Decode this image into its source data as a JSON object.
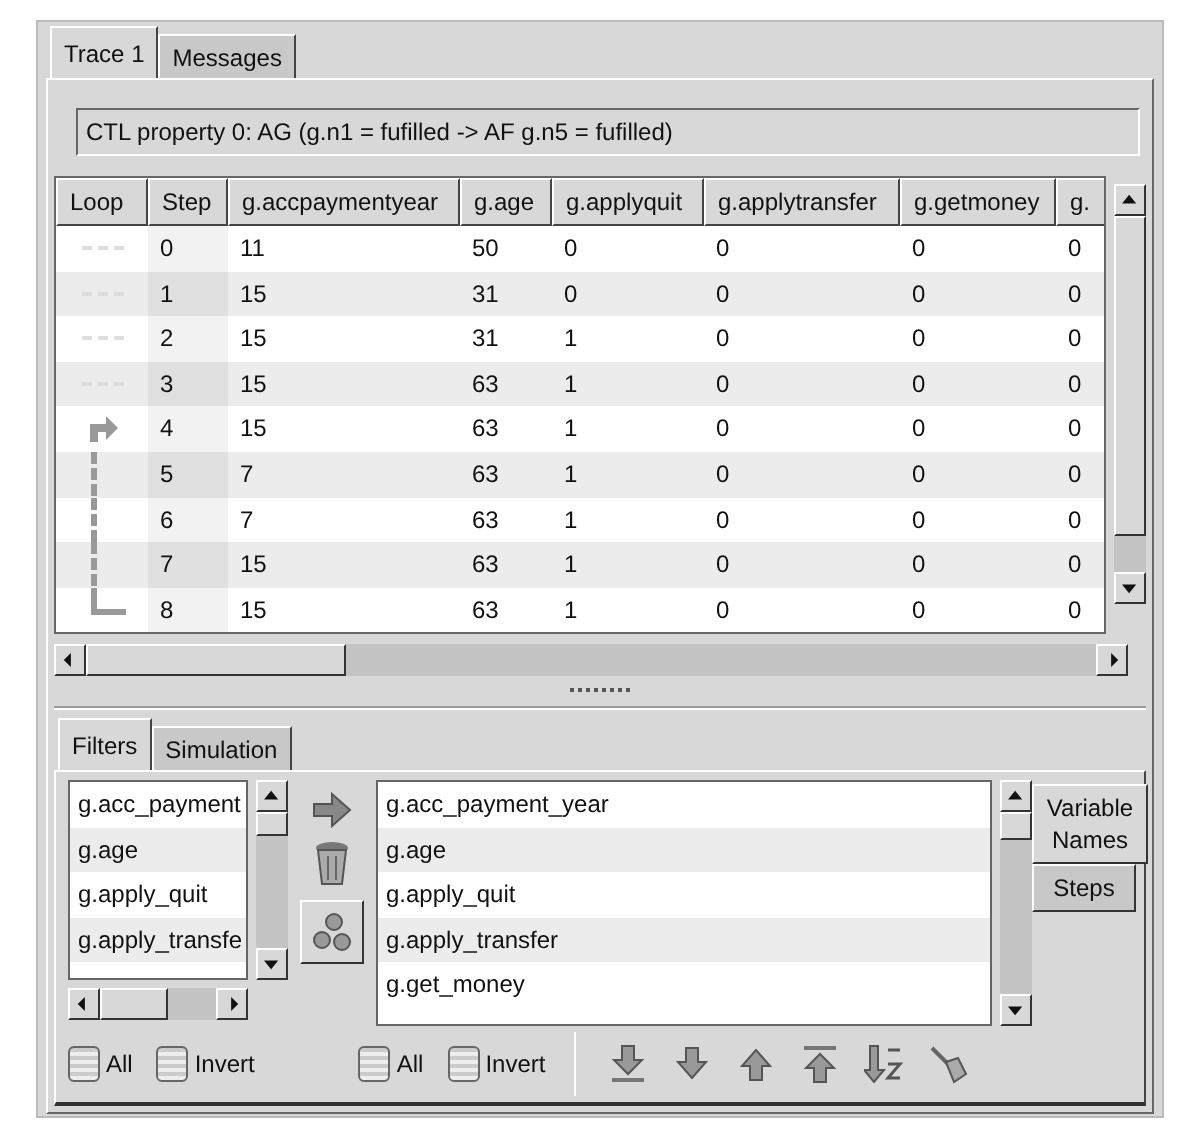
{
  "tabs": [
    {
      "label": "Trace 1",
      "selected": true
    },
    {
      "label": "Messages",
      "selected": false
    }
  ],
  "property": "CTL property 0: AG (g.n1 = fufilled -> AF g.n5 = fufilled)",
  "table": {
    "columns": [
      "Loop",
      "Step",
      "g.accpaymentyear",
      "g.age",
      "g.applyquit",
      "g.applytransfer",
      "g.getmoney",
      "g."
    ],
    "rows": [
      {
        "kind": "none",
        "cells": [
          "",
          "0",
          "11",
          "50",
          "0",
          "0",
          "0",
          "0"
        ]
      },
      {
        "kind": "none",
        "cells": [
          "",
          "1",
          "15",
          "31",
          "0",
          "0",
          "0",
          "0"
        ]
      },
      {
        "kind": "none",
        "cells": [
          "",
          "2",
          "15",
          "31",
          "1",
          "0",
          "0",
          "0"
        ]
      },
      {
        "kind": "none",
        "cells": [
          "",
          "3",
          "15",
          "63",
          "1",
          "0",
          "0",
          "0"
        ]
      },
      {
        "kind": "start",
        "cells": [
          "",
          "4",
          "15",
          "63",
          "1",
          "0",
          "0",
          "0"
        ]
      },
      {
        "kind": "middle",
        "cells": [
          "",
          "5",
          "7",
          "63",
          "1",
          "0",
          "0",
          "0"
        ]
      },
      {
        "kind": "middle",
        "cells": [
          "",
          "6",
          "7",
          "63",
          "1",
          "0",
          "0",
          "0"
        ]
      },
      {
        "kind": "middle",
        "cells": [
          "",
          "7",
          "15",
          "63",
          "1",
          "0",
          "0",
          "0"
        ]
      },
      {
        "kind": "end",
        "cells": [
          "",
          "8",
          "15",
          "63",
          "1",
          "0",
          "0",
          "0"
        ]
      }
    ]
  },
  "lower_tabs": [
    {
      "label": "Filters",
      "selected": true
    },
    {
      "label": "Simulation",
      "selected": false
    }
  ],
  "available": [
    "g.acc_payment",
    "g.age",
    "g.apply_quit",
    "g.apply_transfe"
  ],
  "selected_vars": [
    "g.acc_payment_year",
    "g.age",
    "g.apply_quit",
    "g.apply_transfer",
    "g.get_money"
  ],
  "side_tabs": [
    {
      "label": "Variable Names",
      "selected": true
    },
    {
      "label": "Steps",
      "selected": false
    }
  ],
  "left_toggles": [
    {
      "label": "All",
      "checked": false
    },
    {
      "label": "Invert",
      "checked": false
    }
  ],
  "right_toggles": [
    {
      "label": "All",
      "checked": false
    },
    {
      "label": "Invert",
      "checked": false
    }
  ]
}
